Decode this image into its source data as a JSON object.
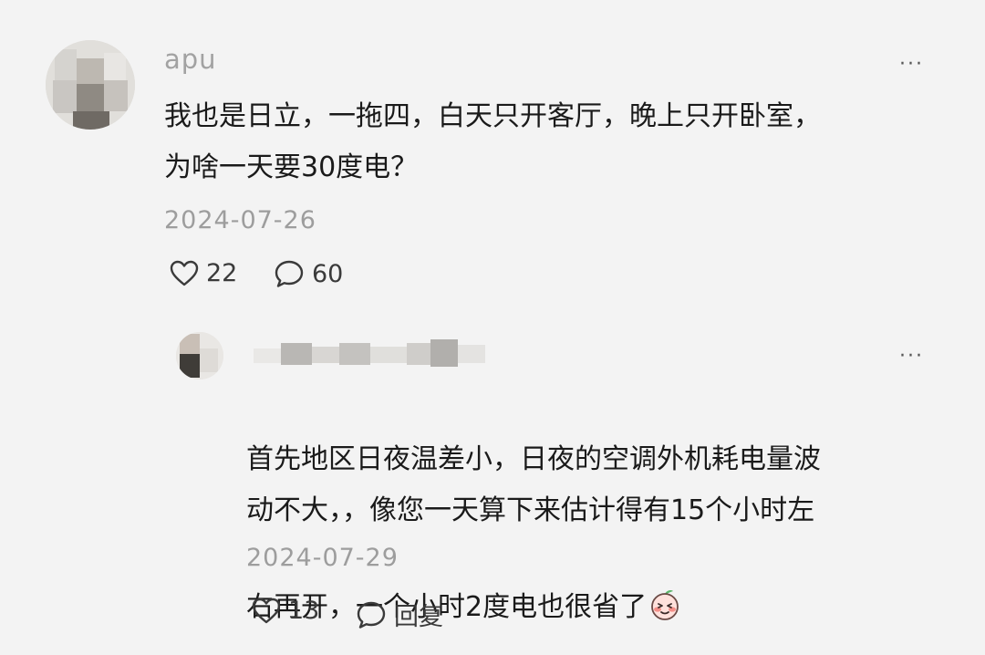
{
  "comment": {
    "username": "apu",
    "text": "我也是日立，一拖四，白天只开客厅，晚上只开卧室，\n为啥一天要30度电？",
    "date": "2024-07-26",
    "likes": "22",
    "replies": "60",
    "more_label": "···"
  },
  "reply": {
    "text": "首先地区日夜温差小，日夜的空调外机耗电量波\n动不大，，像您一天算下来估计得有15个小时左\n右再开，一个小时2度电也很省了",
    "date": "2024-07-29",
    "likes": "13",
    "reply_label": "回复",
    "more_label": "···",
    "emoji": "peach-blush-emoji"
  },
  "icons": {
    "like": "heart-outline-icon",
    "comment": "speech-bubble-icon",
    "more": "ellipsis-icon"
  },
  "colors": {
    "background": "#f3f3f3",
    "text": "#1a1a1a",
    "muted": "#9d9d9d",
    "emoji": "#f0a8a0"
  }
}
